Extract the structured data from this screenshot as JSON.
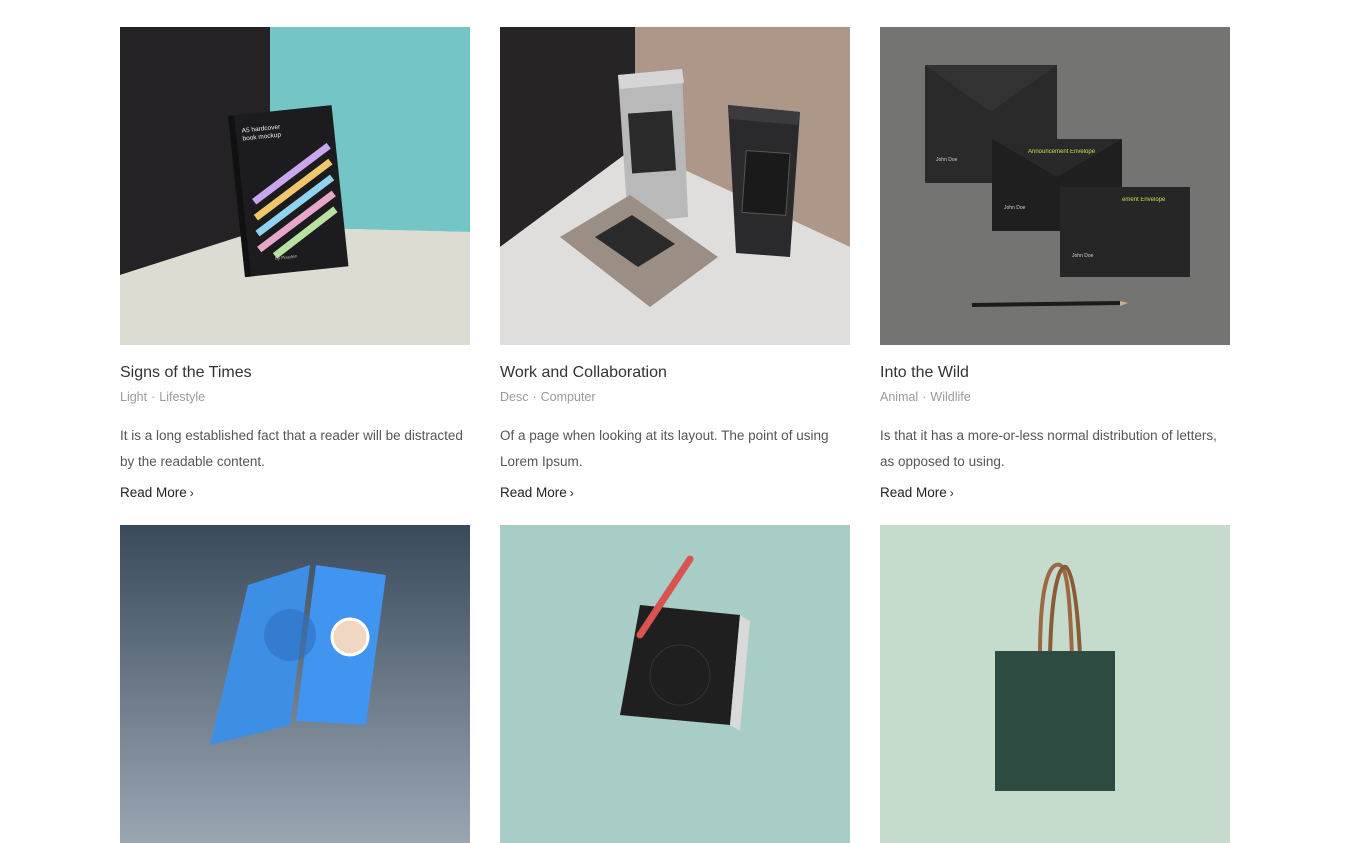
{
  "posts": [
    {
      "title": "Signs of the Times",
      "category": "Light",
      "subcategory": "Lifestyle",
      "excerpt": "It is a long established fact that a reader will be distracted by the readable content.",
      "read_more": "Read More",
      "image_icon": "book-mockup-image",
      "image_text": {
        "book_label": "A5 hardcover book mockup",
        "book_brand": "by Pixeden"
      }
    },
    {
      "title": "Work and Collaboration",
      "category": "Desc",
      "subcategory": "Computer",
      "excerpt": "Of a page when looking at its layout. The point of using Lorem Ipsum.",
      "read_more": "Read More",
      "image_icon": "pouch-mockup-image"
    },
    {
      "title": "Into the Wild",
      "category": "Animal",
      "subcategory": "Wildlife",
      "excerpt": "Is that it has a more-or-less normal distribution of letters, as opposed to using.",
      "read_more": "Read More",
      "image_icon": "envelope-mockup-image",
      "image_text": {
        "envelope_title_1": "Announcement Envelope",
        "envelope_title_2": "ement Envelope",
        "envelope_name": "John Doe"
      }
    }
  ],
  "next_row": [
    {
      "image_icon": "phone-app-mockup-image"
    },
    {
      "image_icon": "notebook-pen-mockup-image"
    },
    {
      "image_icon": "shopping-bag-mockup-image"
    }
  ],
  "colors": {
    "title": "#333333",
    "meta": "#9a9a9a",
    "excerpt": "#555555",
    "link": "#222222",
    "background": "#ffffff"
  },
  "icons": {
    "chevron": "chevron-right-icon"
  }
}
